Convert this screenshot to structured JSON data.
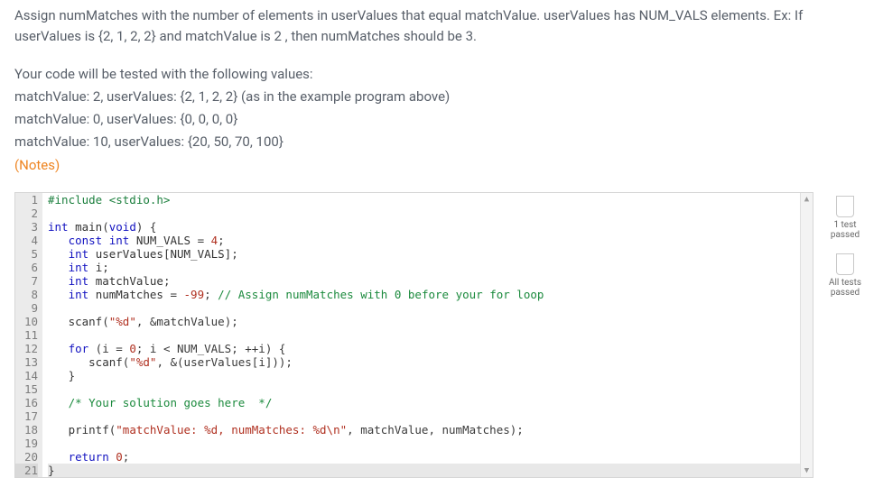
{
  "instructions": {
    "para1": "Assign numMatches with the number of elements in userValues that equal matchValue. userValues has NUM_VALS elements. Ex: If userValues is {2, 1, 2, 2} and matchValue is 2 , then numMatches should be 3.",
    "para2": "Your code will be tested with the following values:",
    "case1": "matchValue: 2, userValues: {2, 1, 2, 2} (as in the example program above)",
    "case2": "matchValue: 0, userValues: {0, 0, 0, 0}",
    "case3": "matchValue: 10, userValues: {20, 50, 70, 100}",
    "notes_label": "(Notes)"
  },
  "editor": {
    "line_count": 21,
    "highlighted_line": 21,
    "lines": {
      "l1": {
        "type": "pre",
        "text": "#include <stdio.h>"
      },
      "l2": {
        "type": "blank",
        "text": ""
      },
      "l3": {
        "type": "sig",
        "kw1": "int",
        "fn": "main",
        "kw2": "void",
        "tail": ") {"
      },
      "l4": {
        "type": "decl",
        "indent": "   ",
        "kw": "const int",
        "id": "NUM_VALS",
        "assign": " = ",
        "num": "4",
        "tail": ";"
      },
      "l5": {
        "type": "decl2",
        "indent": "   ",
        "kw": "int",
        "id": "userValues[NUM_VALS]",
        "tail": ";"
      },
      "l6": {
        "type": "decl2",
        "indent": "   ",
        "kw": "int",
        "id": "i",
        "tail": ";"
      },
      "l7": {
        "type": "decl2",
        "indent": "   ",
        "kw": "int",
        "id": "matchValue",
        "tail": ";"
      },
      "l8": {
        "type": "decl3",
        "indent": "   ",
        "kw": "int",
        "id": "numMatches",
        "assign": " = ",
        "num": "-99",
        "tail": "; ",
        "cmt": "// Assign numMatches with 0 before your for loop"
      },
      "l9": {
        "type": "blank",
        "text": ""
      },
      "l10": {
        "type": "call",
        "indent": "   ",
        "fn": "scanf",
        "open": "(",
        "str": "\"%d\"",
        "mid": ", &matchValue);"
      },
      "l11": {
        "type": "blank",
        "text": ""
      },
      "l12": {
        "type": "for",
        "indent": "   ",
        "kw": "for",
        "body": " (i = ",
        "num0": "0",
        "mid1": "; i < NUM_VALS; ++i) {"
      },
      "l13": {
        "type": "call",
        "indent": "      ",
        "fn": "scanf",
        "open": "(",
        "str": "\"%d\"",
        "mid": ", &(userValues[i]));"
      },
      "l14": {
        "type": "plain",
        "indent": "   ",
        "text": "}"
      },
      "l15": {
        "type": "blank",
        "text": ""
      },
      "l16": {
        "type": "cmt",
        "indent": "   ",
        "text": "/* Your solution goes here  */"
      },
      "l17": {
        "type": "blank",
        "text": ""
      },
      "l18": {
        "type": "call",
        "indent": "   ",
        "fn": "printf",
        "open": "(",
        "str": "\"matchValue: %d, numMatches: %d\\n\"",
        "mid": ", matchValue, numMatches);"
      },
      "l19": {
        "type": "blank",
        "text": ""
      },
      "l20": {
        "type": "ret",
        "indent": "   ",
        "kw": "return",
        "sp": " ",
        "num": "0",
        "tail": ";"
      },
      "l21": {
        "type": "plain",
        "indent": "",
        "text": "}"
      }
    }
  },
  "status": {
    "one_test": "1 test\npassed",
    "all_tests": "All tests\npassed"
  }
}
